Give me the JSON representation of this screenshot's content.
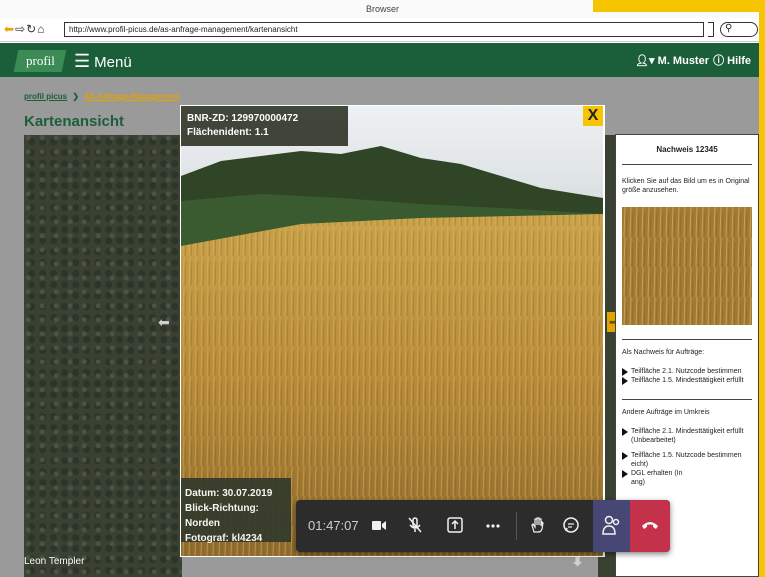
{
  "browser": {
    "title": "Browser",
    "url": "http://www.profil-picus.de/as-anfrage-management/kartenansicht",
    "search_icon": "search-icon"
  },
  "header": {
    "logo": "profil",
    "menu_label": "Menü",
    "user_name": "M. Muster",
    "help_label": "Hilfe"
  },
  "breadcrumb": {
    "home": "profil picus",
    "current": "AS-Anfrage-Management"
  },
  "page": {
    "title": "Kartenansicht"
  },
  "photo": {
    "bnr": "BNR-ZD: 129970000472",
    "flaechenident": "Flächenident: 1.1",
    "datum": "Datum: 30.07.2019",
    "blickrichtung": "Blick-Richtung: Norden",
    "fotograf": "Fotograf: kl4234",
    "close_label": "X"
  },
  "panel": {
    "title": "Nachweis 12345",
    "hint": "Klicken Sie auf das Bild um es in Original größe anzusehen.",
    "orders_heading": "Als Nachweis für Aufträge:",
    "orders": [
      "Teilfläche 2.1. Nutzcode bestimmen",
      "Teilfläche 1.5. Mindesttätigkeit erfüllt"
    ],
    "other_heading": "Andere Aufträge im Umkreis",
    "other": [
      "Teilfläche 2.1. Mindesttätigkeit erfüllt (Unbearbeitet)",
      "Teilfläche 1.5. Nutzcode bestimmen",
      "eicht)",
      "DGL erhalten (In",
      "ang)"
    ]
  },
  "call": {
    "timer": "01:47:07",
    "participant": "Leon Templer"
  },
  "colors": {
    "brand_green": "#1b5e3a",
    "accent_yellow": "#f6c400",
    "hangup_red": "#c4314b",
    "participants_purple": "#464775"
  }
}
